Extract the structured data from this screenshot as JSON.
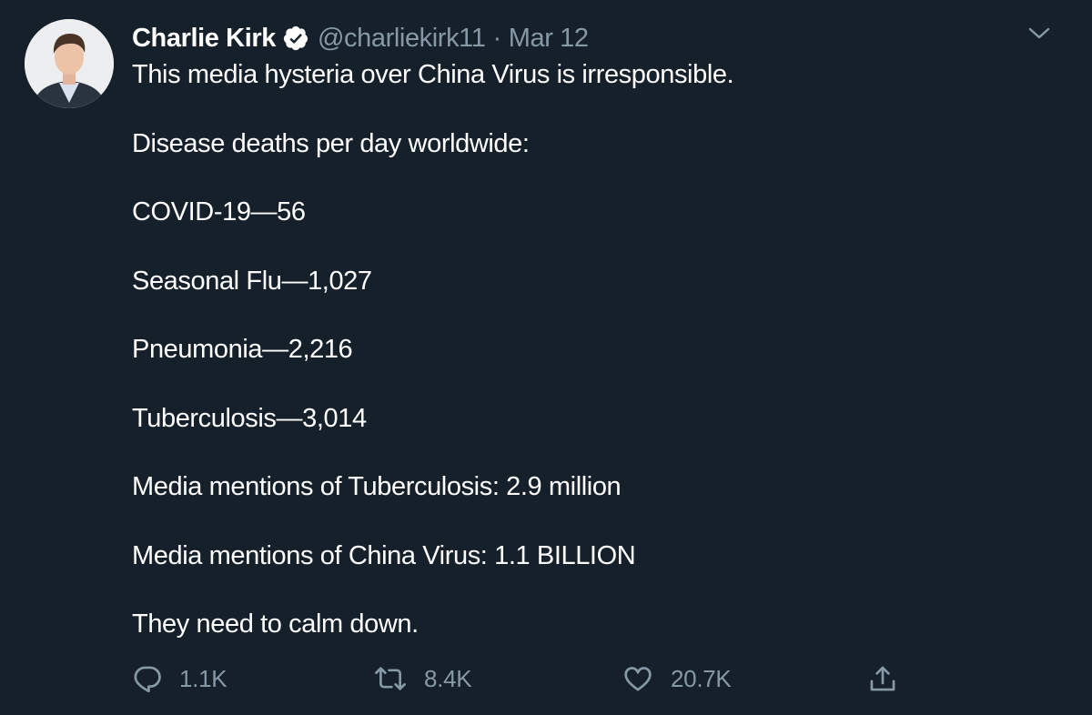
{
  "tweet": {
    "author": {
      "display_name": "Charlie Kirk",
      "handle": "@charliekirk11",
      "verified": true,
      "avatar_icon": "profile-photo"
    },
    "separator": "·",
    "date": "Mar 12",
    "lines": [
      "This media hysteria over China Virus is irresponsible.",
      "Disease deaths per day worldwide:",
      "COVID-19—56",
      "Seasonal Flu—1,027",
      "Pneumonia—2,216",
      "Tuberculosis—3,014",
      "Media mentions of Tuberculosis: 2.9 million",
      "Media mentions of China Virus: 1.1 BILLION",
      "They need to calm down."
    ],
    "actions": {
      "reply": {
        "icon": "reply-icon",
        "count": "1.1K"
      },
      "retweet": {
        "icon": "retweet-icon",
        "count": "8.4K"
      },
      "like": {
        "icon": "heart-icon",
        "count": "20.7K"
      },
      "share": {
        "icon": "share-icon"
      }
    }
  },
  "colors": {
    "background": "#15202b",
    "text": "#ffffff",
    "secondary": "#8899a6"
  }
}
